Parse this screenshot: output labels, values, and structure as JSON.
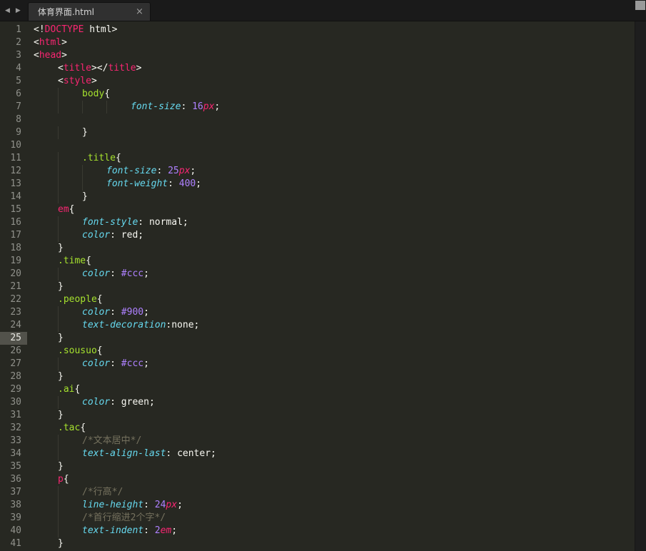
{
  "theme": {
    "bg": "#272822",
    "fg": "#f8f8f2",
    "gutterFg": "#90918b",
    "curBg": "#52524b",
    "curFg": "#e8e8e2",
    "pink": "#f92672",
    "green": "#a6e22e",
    "cyan": "#66d9ef",
    "purple": "#ae81ff",
    "comment": "#75715e",
    "guide": "#3a3a32",
    "tabbarBg": "#1a1a1a",
    "tabBg": "#303030",
    "tabFg": "#d6d6d6",
    "stripBg": "#1e1e1e"
  },
  "tab_bar": {
    "scroll_left": "◀",
    "scroll_right": "▶",
    "tabs": [
      {
        "label": "体育界面.html",
        "close": "×",
        "active": true
      }
    ]
  },
  "editor": {
    "current_line": 25,
    "lines": [
      {
        "n": 1,
        "i": 0,
        "tk": [
          [
            "<!",
            "pl"
          ],
          [
            "DOCTYPE",
            "tag"
          ],
          [
            " html",
            "pl"
          ],
          [
            ">",
            "pl"
          ]
        ]
      },
      {
        "n": 2,
        "i": 0,
        "tk": [
          [
            "<",
            "pl"
          ],
          [
            "html",
            "tag"
          ],
          [
            ">",
            "pl"
          ]
        ]
      },
      {
        "n": 3,
        "i": 0,
        "tk": [
          [
            "<",
            "pl"
          ],
          [
            "head",
            "tag"
          ],
          [
            ">",
            "pl"
          ]
        ]
      },
      {
        "n": 4,
        "i": 1,
        "tk": [
          [
            "<",
            "pl"
          ],
          [
            "title",
            "tag"
          ],
          [
            "></",
            "pl"
          ],
          [
            "title",
            "tag"
          ],
          [
            ">",
            "pl"
          ]
        ]
      },
      {
        "n": 5,
        "i": 1,
        "tk": [
          [
            "<",
            "pl"
          ],
          [
            "style",
            "tag"
          ],
          [
            ">",
            "pl"
          ]
        ]
      },
      {
        "n": 6,
        "i": 2,
        "tk": [
          [
            "body",
            "cls"
          ],
          [
            "{",
            "pl"
          ]
        ]
      },
      {
        "n": 7,
        "i": 4,
        "tk": [
          [
            "font-size",
            "prop"
          ],
          [
            ": ",
            "pl"
          ],
          [
            "16",
            "num"
          ],
          [
            "px",
            "unit"
          ],
          [
            ";",
            "pl"
          ]
        ]
      },
      {
        "n": 8,
        "i": 0,
        "tk": []
      },
      {
        "n": 9,
        "i": 2,
        "tk": [
          [
            "}",
            "pl"
          ]
        ]
      },
      {
        "n": 10,
        "i": 0,
        "tk": []
      },
      {
        "n": 11,
        "i": 2,
        "tk": [
          [
            ".title",
            "cls"
          ],
          [
            "{",
            "pl"
          ]
        ]
      },
      {
        "n": 12,
        "i": 3,
        "tk": [
          [
            "font-size",
            "prop"
          ],
          [
            ": ",
            "pl"
          ],
          [
            "25",
            "num"
          ],
          [
            "px",
            "unit"
          ],
          [
            ";",
            "pl"
          ]
        ]
      },
      {
        "n": 13,
        "i": 3,
        "tk": [
          [
            "font-weight",
            "prop"
          ],
          [
            ": ",
            "pl"
          ],
          [
            "400",
            "num"
          ],
          [
            ";",
            "pl"
          ]
        ]
      },
      {
        "n": 14,
        "i": 2,
        "tk": [
          [
            "}",
            "pl"
          ]
        ]
      },
      {
        "n": 15,
        "i": 1,
        "tk": [
          [
            "em",
            "tag"
          ],
          [
            "{",
            "pl"
          ]
        ]
      },
      {
        "n": 16,
        "i": 2,
        "tk": [
          [
            "font-style",
            "prop"
          ],
          [
            ": ",
            "pl"
          ],
          [
            "normal",
            "val"
          ],
          [
            ";",
            "pl"
          ]
        ]
      },
      {
        "n": 17,
        "i": 2,
        "tk": [
          [
            "color",
            "prop"
          ],
          [
            ": ",
            "pl"
          ],
          [
            "red",
            "val"
          ],
          [
            ";",
            "pl"
          ]
        ]
      },
      {
        "n": 18,
        "i": 1,
        "tk": [
          [
            "}",
            "pl"
          ]
        ]
      },
      {
        "n": 19,
        "i": 1,
        "tk": [
          [
            ".time",
            "cls"
          ],
          [
            "{",
            "pl"
          ]
        ]
      },
      {
        "n": 20,
        "i": 2,
        "tk": [
          [
            "color",
            "prop"
          ],
          [
            ": ",
            "pl"
          ],
          [
            "#ccc",
            "num"
          ],
          [
            ";",
            "pl"
          ]
        ]
      },
      {
        "n": 21,
        "i": 1,
        "tk": [
          [
            "}",
            "pl"
          ]
        ]
      },
      {
        "n": 22,
        "i": 1,
        "tk": [
          [
            ".people",
            "cls"
          ],
          [
            "{",
            "pl"
          ]
        ]
      },
      {
        "n": 23,
        "i": 2,
        "tk": [
          [
            "color",
            "prop"
          ],
          [
            ": ",
            "pl"
          ],
          [
            "#900",
            "num"
          ],
          [
            ";",
            "pl"
          ]
        ]
      },
      {
        "n": 24,
        "i": 2,
        "tk": [
          [
            "text-decoration",
            "prop"
          ],
          [
            ":",
            "pl"
          ],
          [
            "none",
            "val"
          ],
          [
            ";",
            "pl"
          ]
        ]
      },
      {
        "n": 25,
        "i": 1,
        "tk": [
          [
            "}",
            "pl"
          ]
        ]
      },
      {
        "n": 26,
        "i": 1,
        "tk": [
          [
            ".sousuo",
            "cls"
          ],
          [
            "{",
            "pl"
          ]
        ]
      },
      {
        "n": 27,
        "i": 2,
        "tk": [
          [
            "color",
            "prop"
          ],
          [
            ": ",
            "pl"
          ],
          [
            "#ccc",
            "num"
          ],
          [
            ";",
            "pl"
          ]
        ]
      },
      {
        "n": 28,
        "i": 1,
        "tk": [
          [
            "}",
            "pl"
          ]
        ]
      },
      {
        "n": 29,
        "i": 1,
        "tk": [
          [
            ".ai",
            "cls"
          ],
          [
            "{",
            "pl"
          ]
        ]
      },
      {
        "n": 30,
        "i": 2,
        "tk": [
          [
            "color",
            "prop"
          ],
          [
            ": ",
            "pl"
          ],
          [
            "green",
            "val"
          ],
          [
            ";",
            "pl"
          ]
        ]
      },
      {
        "n": 31,
        "i": 1,
        "tk": [
          [
            "}",
            "pl"
          ]
        ]
      },
      {
        "n": 32,
        "i": 1,
        "tk": [
          [
            ".tac",
            "cls"
          ],
          [
            "{",
            "pl"
          ]
        ]
      },
      {
        "n": 33,
        "i": 2,
        "tk": [
          [
            "/*文本居中*/",
            "com"
          ]
        ]
      },
      {
        "n": 34,
        "i": 2,
        "tk": [
          [
            "text-align-last",
            "prop"
          ],
          [
            ": ",
            "pl"
          ],
          [
            "center",
            "val"
          ],
          [
            ";",
            "pl"
          ]
        ]
      },
      {
        "n": 35,
        "i": 1,
        "tk": [
          [
            "}",
            "pl"
          ]
        ]
      },
      {
        "n": 36,
        "i": 1,
        "tk": [
          [
            "p",
            "tag"
          ],
          [
            "{",
            "pl"
          ]
        ]
      },
      {
        "n": 37,
        "i": 2,
        "tk": [
          [
            "/*行高*/",
            "com"
          ]
        ]
      },
      {
        "n": 38,
        "i": 2,
        "tk": [
          [
            "line-height",
            "prop"
          ],
          [
            ": ",
            "pl"
          ],
          [
            "24",
            "num"
          ],
          [
            "px",
            "unit"
          ],
          [
            ";",
            "pl"
          ]
        ]
      },
      {
        "n": 39,
        "i": 2,
        "tk": [
          [
            "/*首行缩进2个字*/",
            "com"
          ]
        ]
      },
      {
        "n": 40,
        "i": 2,
        "tk": [
          [
            "text-indent",
            "prop"
          ],
          [
            ": ",
            "pl"
          ],
          [
            "2",
            "num"
          ],
          [
            "em",
            "unit"
          ],
          [
            ";",
            "pl"
          ]
        ]
      },
      {
        "n": 41,
        "i": 1,
        "tk": [
          [
            "}",
            "pl"
          ]
        ]
      }
    ]
  }
}
